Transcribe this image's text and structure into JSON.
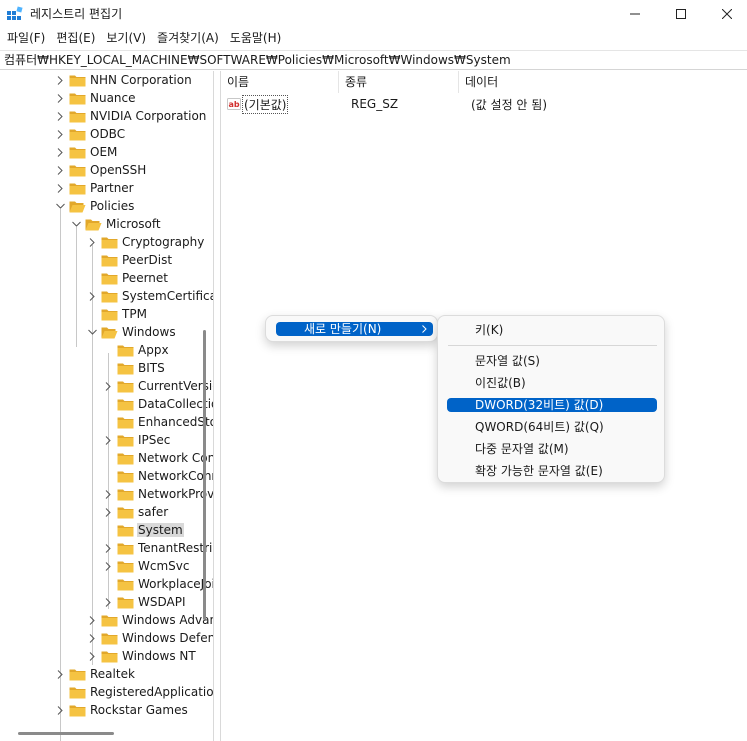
{
  "window": {
    "title": "레지스트리 편집기",
    "icon": "registry-editor-icon"
  },
  "menubar": {
    "items": [
      "파일(F)",
      "편집(E)",
      "보기(V)",
      "즐겨찾기(A)",
      "도움말(H)"
    ]
  },
  "address": {
    "path": "컴퓨터₩HKEY_LOCAL_MACHINE₩SOFTWARE₩Policies₩Microsoft₩Windows₩System"
  },
  "tree": {
    "items": [
      {
        "label": "NHN Corporation",
        "depth": 0,
        "expander": "collapsed",
        "selected": false
      },
      {
        "label": "Nuance",
        "depth": 0,
        "expander": "collapsed",
        "selected": false
      },
      {
        "label": "NVIDIA Corporation",
        "depth": 0,
        "expander": "collapsed",
        "selected": false
      },
      {
        "label": "ODBC",
        "depth": 0,
        "expander": "collapsed",
        "selected": false
      },
      {
        "label": "OEM",
        "depth": 0,
        "expander": "collapsed",
        "selected": false
      },
      {
        "label": "OpenSSH",
        "depth": 0,
        "expander": "collapsed",
        "selected": false
      },
      {
        "label": "Partner",
        "depth": 0,
        "expander": "collapsed",
        "selected": false
      },
      {
        "label": "Policies",
        "depth": 0,
        "expander": "expanded",
        "selected": false
      },
      {
        "label": "Microsoft",
        "depth": 1,
        "expander": "expanded",
        "selected": false
      },
      {
        "label": "Cryptography",
        "depth": 2,
        "expander": "collapsed",
        "selected": false
      },
      {
        "label": "PeerDist",
        "depth": 2,
        "expander": "none",
        "selected": false
      },
      {
        "label": "Peernet",
        "depth": 2,
        "expander": "none",
        "selected": false
      },
      {
        "label": "SystemCertificates",
        "depth": 2,
        "expander": "collapsed",
        "selected": false
      },
      {
        "label": "TPM",
        "depth": 2,
        "expander": "none",
        "selected": false
      },
      {
        "label": "Windows",
        "depth": 2,
        "expander": "expanded",
        "selected": false
      },
      {
        "label": "Appx",
        "depth": 3,
        "expander": "none",
        "selected": false
      },
      {
        "label": "BITS",
        "depth": 3,
        "expander": "none",
        "selected": false
      },
      {
        "label": "CurrentVersion",
        "depth": 3,
        "expander": "collapsed",
        "selected": false
      },
      {
        "label": "DataCollection",
        "depth": 3,
        "expander": "none",
        "selected": false
      },
      {
        "label": "EnhancedStorageDevices",
        "depth": 3,
        "expander": "none",
        "selected": false
      },
      {
        "label": "IPSec",
        "depth": 3,
        "expander": "collapsed",
        "selected": false
      },
      {
        "label": "Network Connections",
        "depth": 3,
        "expander": "none",
        "selected": false
      },
      {
        "label": "NetworkConnectivityStatusIndicator",
        "depth": 3,
        "expander": "none",
        "selected": false
      },
      {
        "label": "NetworkProvider",
        "depth": 3,
        "expander": "collapsed",
        "selected": false
      },
      {
        "label": "safer",
        "depth": 3,
        "expander": "collapsed",
        "selected": false
      },
      {
        "label": "System",
        "depth": 3,
        "expander": "none",
        "selected": true
      },
      {
        "label": "TenantRestrictions",
        "depth": 3,
        "expander": "collapsed",
        "selected": false
      },
      {
        "label": "WcmSvc",
        "depth": 3,
        "expander": "collapsed",
        "selected": false
      },
      {
        "label": "WorkplaceJoin",
        "depth": 3,
        "expander": "none",
        "selected": false
      },
      {
        "label": "WSDAPI",
        "depth": 3,
        "expander": "collapsed",
        "selected": false
      },
      {
        "label": "Windows Advanced Threat Protection",
        "depth": 2,
        "expander": "collapsed",
        "selected": false
      },
      {
        "label": "Windows Defender",
        "depth": 2,
        "expander": "collapsed",
        "selected": false
      },
      {
        "label": "Windows NT",
        "depth": 2,
        "expander": "collapsed",
        "selected": false
      },
      {
        "label": "Realtek",
        "depth": 0,
        "expander": "collapsed",
        "selected": false
      },
      {
        "label": "RegisteredApplications",
        "depth": 0,
        "expander": "none",
        "selected": false
      },
      {
        "label": "Rockstar Games",
        "depth": 0,
        "expander": "collapsed",
        "selected": false
      }
    ]
  },
  "list": {
    "columns": [
      "이름",
      "종류",
      "데이터"
    ],
    "rows": [
      {
        "name": "(기본값)",
        "type": "REG_SZ",
        "data": "(값 설정 안 됨)",
        "icon": "string-value-icon"
      }
    ]
  },
  "context_menu": {
    "parent_item": "새로 만들기(N)",
    "submenu": {
      "key_item": "키(K)",
      "items": [
        "문자열 값(S)",
        "이진값(B)",
        "DWORD(32비트) 값(D)",
        "QWORD(64비트) 값(Q)",
        "다중 문자열 값(M)",
        "확장 가능한 문자열 값(E)"
      ],
      "highlighted_index": 2
    }
  },
  "colors": {
    "accent": "#0063c8",
    "folder": "#f5c342",
    "selection": "#d9d9d9"
  }
}
